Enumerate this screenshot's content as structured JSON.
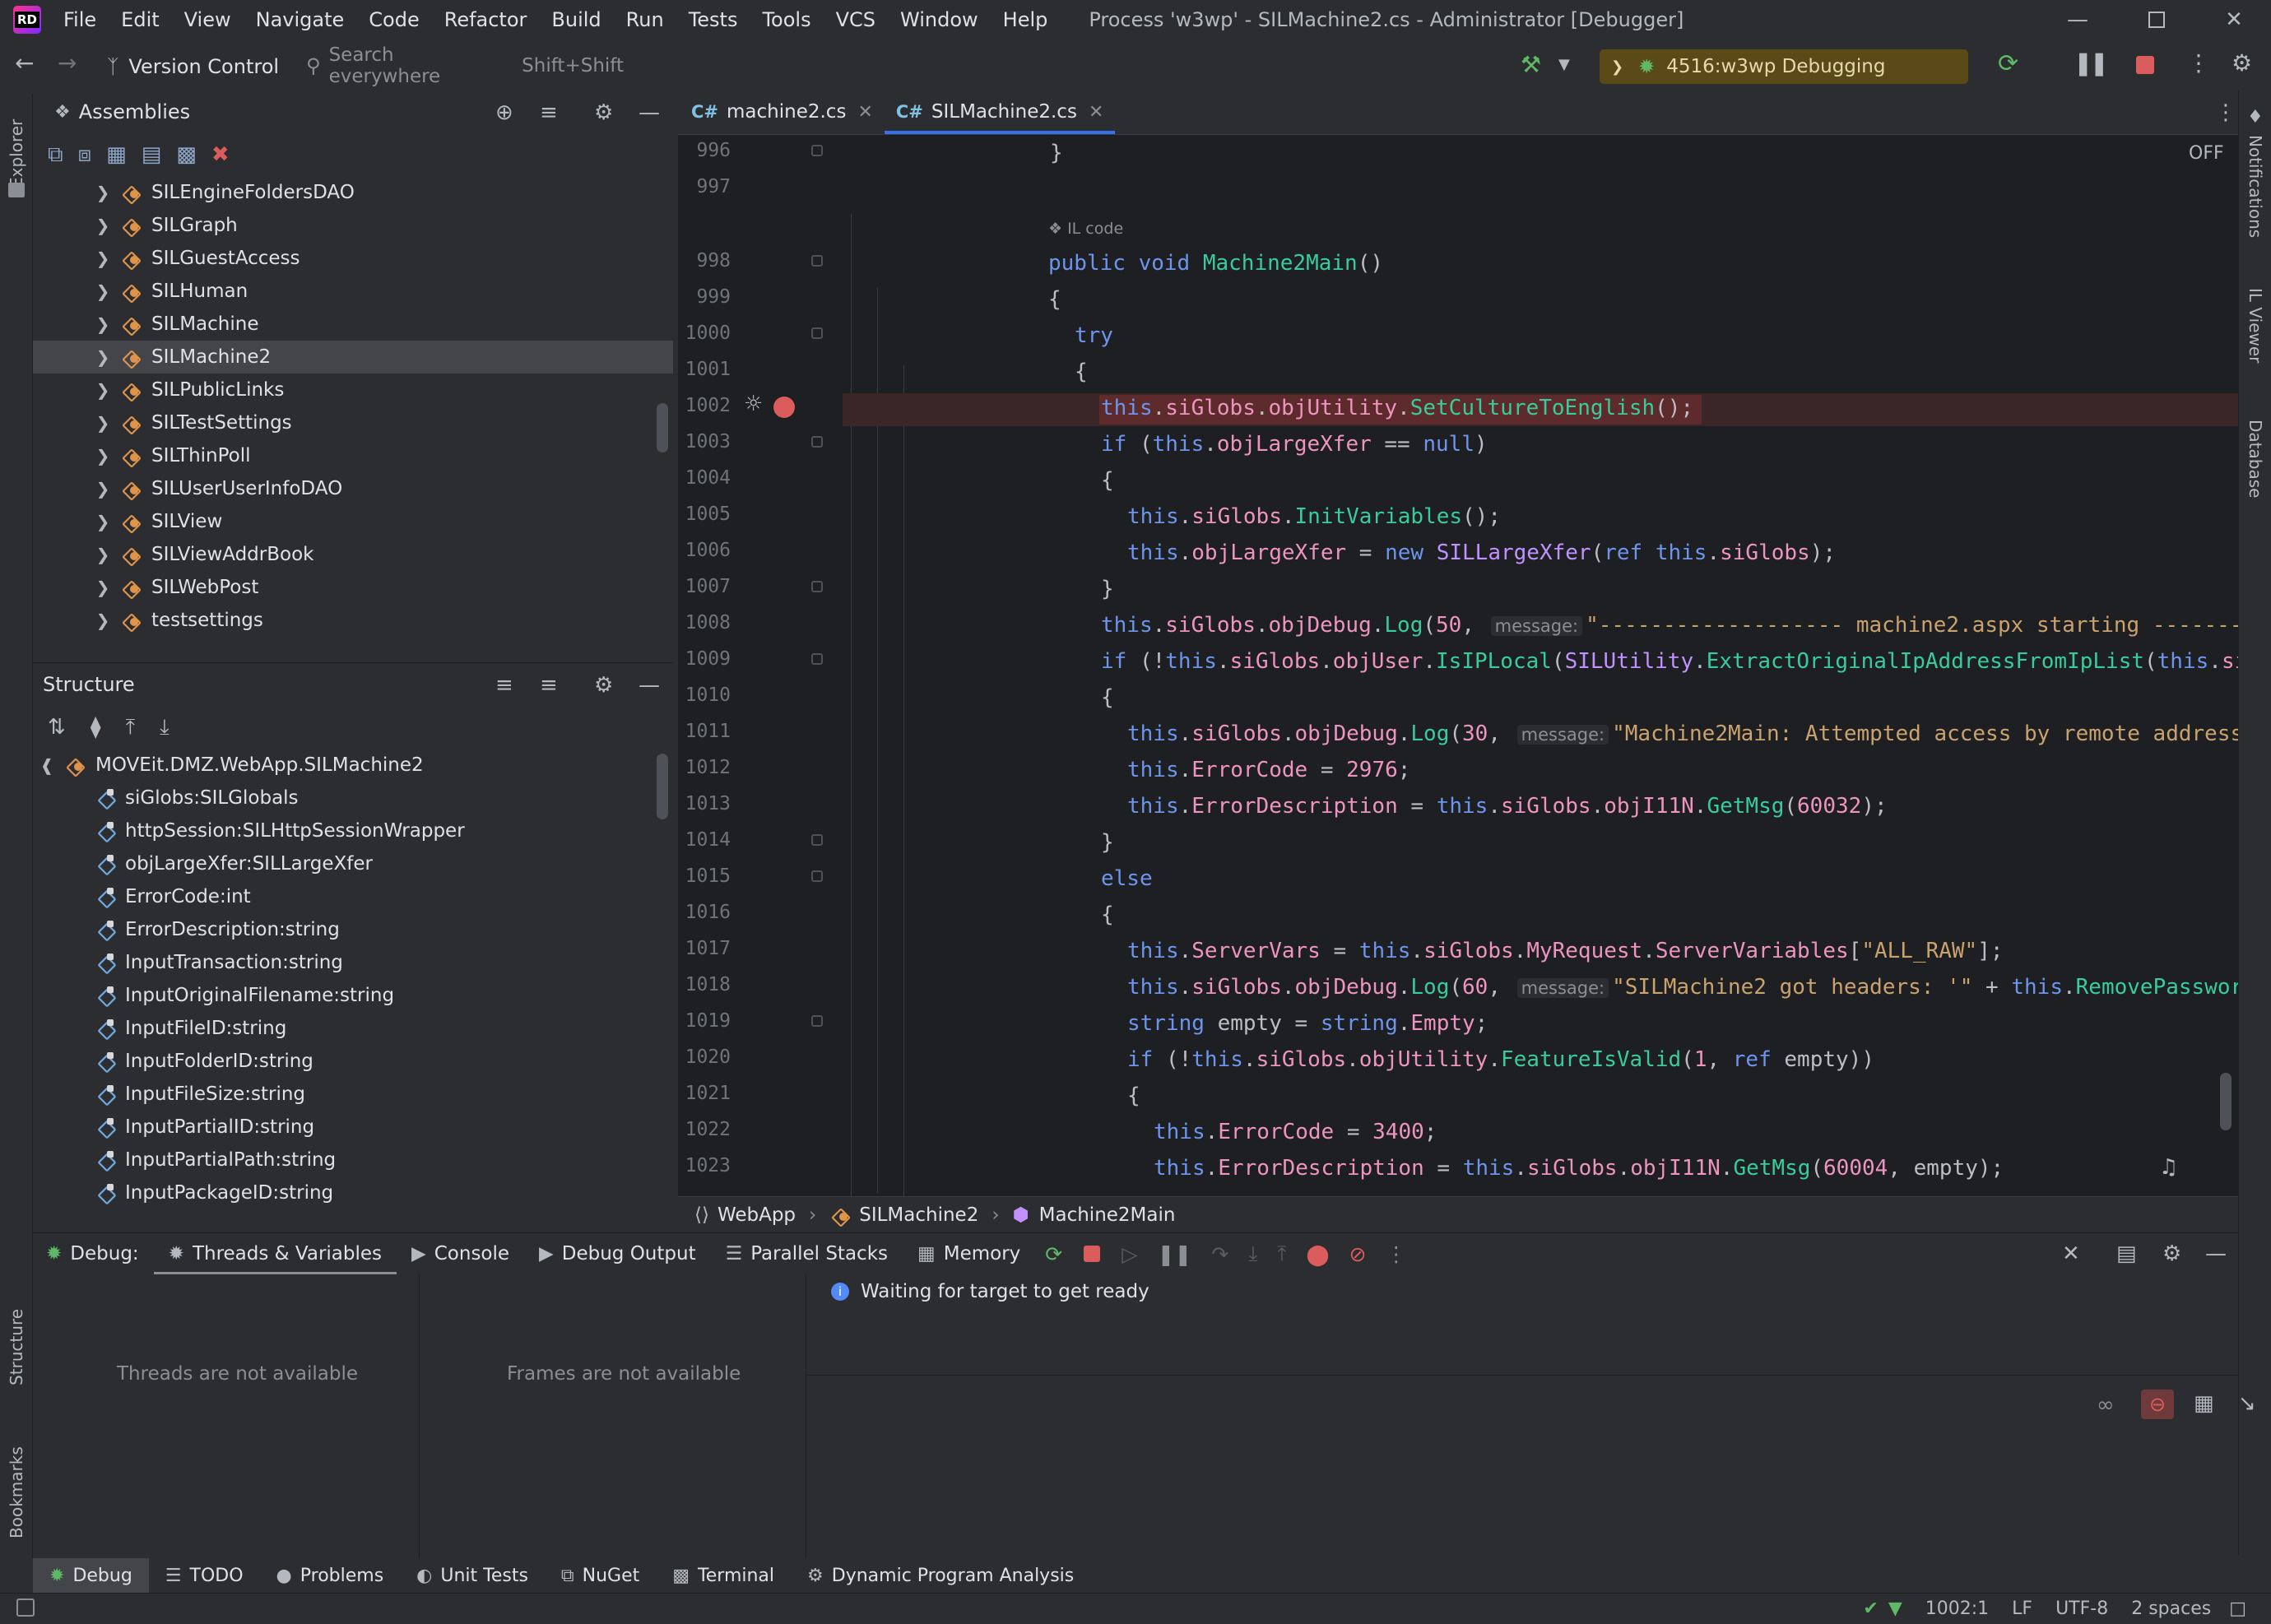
{
  "app": {
    "logo": "RD",
    "menu": [
      "File",
      "Edit",
      "View",
      "Navigate",
      "Code",
      "Refactor",
      "Build",
      "Run",
      "Tests",
      "Tools",
      "VCS",
      "Window",
      "Help"
    ],
    "window_title": "Process 'w3wp' - SILMachine2.cs - Administrator [Debugger]"
  },
  "toolbar": {
    "version_control": "Version Control",
    "search_placeholder": "Search everywhere",
    "search_shortcut": "Shift+Shift",
    "run_config": "4516:w3wp Debugging",
    "colors": {
      "debug_config_bg": "#5a4a17",
      "accent": "#3574f0"
    }
  },
  "left_stripe": {
    "explorer": "Explorer",
    "structure": "Structure",
    "bookmarks": "Bookmarks"
  },
  "right_stripe": {
    "notifications": "Notifications",
    "il_viewer": "IL Viewer",
    "database": "Database"
  },
  "assemblies": {
    "title": "Assemblies",
    "items": [
      {
        "label": "SILEngineFoldersDAO",
        "selected": false
      },
      {
        "label": "SILGraph",
        "selected": false
      },
      {
        "label": "SILGuestAccess",
        "selected": false
      },
      {
        "label": "SILHuman",
        "selected": false
      },
      {
        "label": "SILMachine",
        "selected": false
      },
      {
        "label": "SILMachine2",
        "selected": true
      },
      {
        "label": "SILPublicLinks",
        "selected": false
      },
      {
        "label": "SILTestSettings",
        "selected": false
      },
      {
        "label": "SILThinPoll",
        "selected": false
      },
      {
        "label": "SILUserUserInfoDAO",
        "selected": false
      },
      {
        "label": "SILView",
        "selected": false
      },
      {
        "label": "SILViewAddrBook",
        "selected": false
      },
      {
        "label": "SILWebPost",
        "selected": false
      },
      {
        "label": "testsettings",
        "selected": false
      }
    ]
  },
  "structure": {
    "title": "Structure",
    "root": "MOVEit.DMZ.WebApp.SILMachine2",
    "items": [
      "siGlobs:SILGlobals",
      "httpSession:SILHttpSessionWrapper",
      "objLargeXfer:SILLargeXfer",
      "ErrorCode:int",
      "ErrorDescription:string",
      "InputTransaction:string",
      "InputOriginalFilename:string",
      "InputFileID:string",
      "InputFolderID:string",
      "InputFileSize:string",
      "InputPartialID:string",
      "InputPartialPath:string",
      "InputPackageID:string"
    ]
  },
  "editor": {
    "tabs": [
      {
        "lang": "C#",
        "label": "machine2.cs",
        "active": false
      },
      {
        "lang": "C#",
        "label": "SILMachine2.cs",
        "active": true
      }
    ],
    "off_label": "OFF",
    "il_code_label": "IL code",
    "line_numbers": [
      "996",
      "997",
      "998",
      "999",
      "1000",
      "1001",
      "1002",
      "1003",
      "1004",
      "1005",
      "1006",
      "1007",
      "1008",
      "1009",
      "1010",
      "1011",
      "1012",
      "1013",
      "1014",
      "1015",
      "1016",
      "1017",
      "1018",
      "1019",
      "1020",
      "1021",
      "1022",
      "1023"
    ],
    "hint_label": "message:",
    "breakpoint_line": "1002",
    "breadcrumbs": [
      "WebApp",
      "SILMachine2",
      "Machine2Main"
    ]
  },
  "debug": {
    "label": "Debug:",
    "tabs": [
      "Threads & Variables",
      "Console",
      "Debug Output",
      "Parallel Stacks",
      "Memory"
    ],
    "status_message": "Waiting for target to get ready",
    "threads_empty": "Threads are not available",
    "frames_empty": "Frames are not available"
  },
  "bottom_tools": [
    "Debug",
    "TODO",
    "Problems",
    "Unit Tests",
    "NuGet",
    "Terminal",
    "Dynamic Program Analysis"
  ],
  "status": {
    "position": "1002:1",
    "line_ending": "LF",
    "encoding": "UTF-8",
    "indent": "2 spaces"
  }
}
